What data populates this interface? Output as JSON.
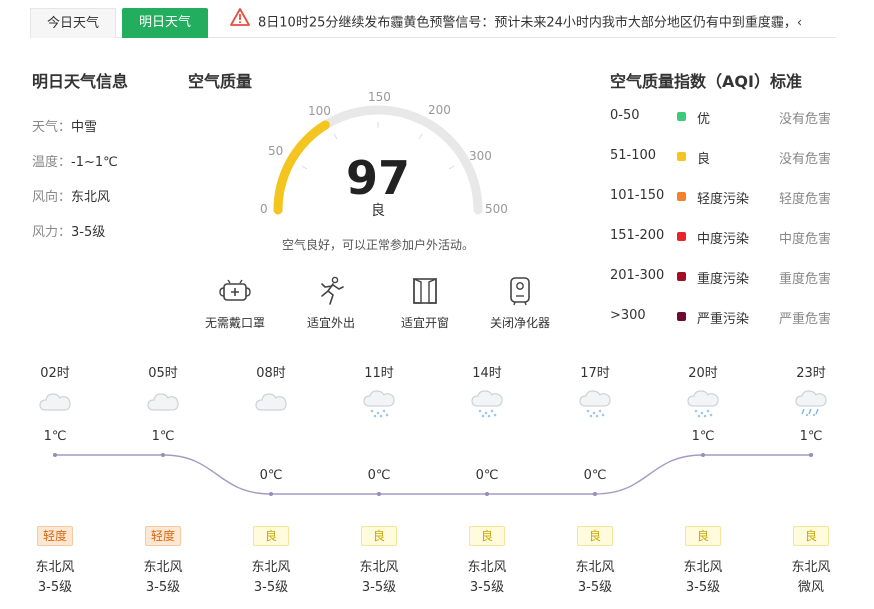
{
  "tabs": [
    {
      "label": "今日天气",
      "active": false
    },
    {
      "label": "明日天气",
      "active": true
    }
  ],
  "alert": {
    "text": "8日10时25分继续发布霾黄色预警信号：预计未来24小时内我市大部分地区仍有中到重度霾，‹",
    "icon": "warning-triangle-icon",
    "color": "#e94c3d"
  },
  "tomorrow": {
    "title": "明日天气信息",
    "rows": [
      {
        "label": "天气：",
        "value": "中雪"
      },
      {
        "label": "温度：",
        "value": "-1~1℃"
      },
      {
        "label": "风向：",
        "value": "东北风"
      },
      {
        "label": "风力：",
        "value": "3-5级"
      }
    ]
  },
  "air_quality": {
    "title": "空气质量",
    "aqi": "97",
    "aqi_number": 97,
    "scale_max": 500,
    "level": "良",
    "description": "空气良好，可以正常参加户外活动。",
    "ticks": [
      "0",
      "50",
      "100",
      "150",
      "200",
      "300",
      "500"
    ],
    "gauge_color": "#f5c51f",
    "track_color": "#e8e8e8",
    "advice": [
      {
        "label": "无需戴口罩",
        "icon": "mask-icon"
      },
      {
        "label": "适宜外出",
        "icon": "running-person-icon"
      },
      {
        "label": "适宜开窗",
        "icon": "window-icon"
      },
      {
        "label": "关闭净化器",
        "icon": "air-purifier-icon"
      }
    ]
  },
  "aqi_standard": {
    "title": "空气质量指数（AQI）标准",
    "rows": [
      {
        "range": "0-50",
        "level": "优",
        "effect": "没有危害",
        "color": "#3fc97b"
      },
      {
        "range": "51-100",
        "level": "良",
        "effect": "没有危害",
        "color": "#f5c51f"
      },
      {
        "range": "101-150",
        "level": "轻度污染",
        "effect": "轻度危害",
        "color": "#f2822b"
      },
      {
        "range": "151-200",
        "level": "中度污染",
        "effect": "中度危害",
        "color": "#e8242a"
      },
      {
        "range": "201-300",
        "level": "重度污染",
        "effect": "重度危害",
        "color": "#a10f26"
      },
      {
        "range": ">300",
        "level": "严重污染",
        "effect": "严重危害",
        "color": "#6e0b35"
      }
    ]
  },
  "hourly": [
    {
      "time": "02时",
      "icon": "cloudy-icon",
      "temp": "1℃",
      "temp_value": 1,
      "aqi": "轻度",
      "aqi_class": "light",
      "wind_dir": "东北风",
      "wind_power": "3-5级"
    },
    {
      "time": "05时",
      "icon": "cloudy-icon",
      "temp": "1℃",
      "temp_value": 1,
      "aqi": "轻度",
      "aqi_class": "light",
      "wind_dir": "东北风",
      "wind_power": "3-5级"
    },
    {
      "time": "08时",
      "icon": "cloudy-icon",
      "temp": "0℃",
      "temp_value": 0,
      "aqi": "良",
      "aqi_class": "good",
      "wind_dir": "东北风",
      "wind_power": "3-5级"
    },
    {
      "time": "11时",
      "icon": "snow-icon",
      "temp": "0℃",
      "temp_value": 0,
      "aqi": "良",
      "aqi_class": "good",
      "wind_dir": "东北风",
      "wind_power": "3-5级"
    },
    {
      "time": "14时",
      "icon": "snow-icon",
      "temp": "0℃",
      "temp_value": 0,
      "aqi": "良",
      "aqi_class": "good",
      "wind_dir": "东北风",
      "wind_power": "3-5级"
    },
    {
      "time": "17时",
      "icon": "snow-icon",
      "temp": "0℃",
      "temp_value": 0,
      "aqi": "良",
      "aqi_class": "good",
      "wind_dir": "东北风",
      "wind_power": "3-5级"
    },
    {
      "time": "20时",
      "icon": "snow-icon",
      "temp": "1℃",
      "temp_value": 1,
      "aqi": "良",
      "aqi_class": "good",
      "wind_dir": "东北风",
      "wind_power": "3-5级"
    },
    {
      "time": "23时",
      "icon": "sleet-icon",
      "temp": "1℃",
      "temp_value": 1,
      "aqi": "良",
      "aqi_class": "good",
      "wind_dir": "东北风",
      "wind_power": "微风"
    }
  ],
  "colors": {
    "accent_green": "#23ad5e",
    "curve": "#a899c3"
  }
}
